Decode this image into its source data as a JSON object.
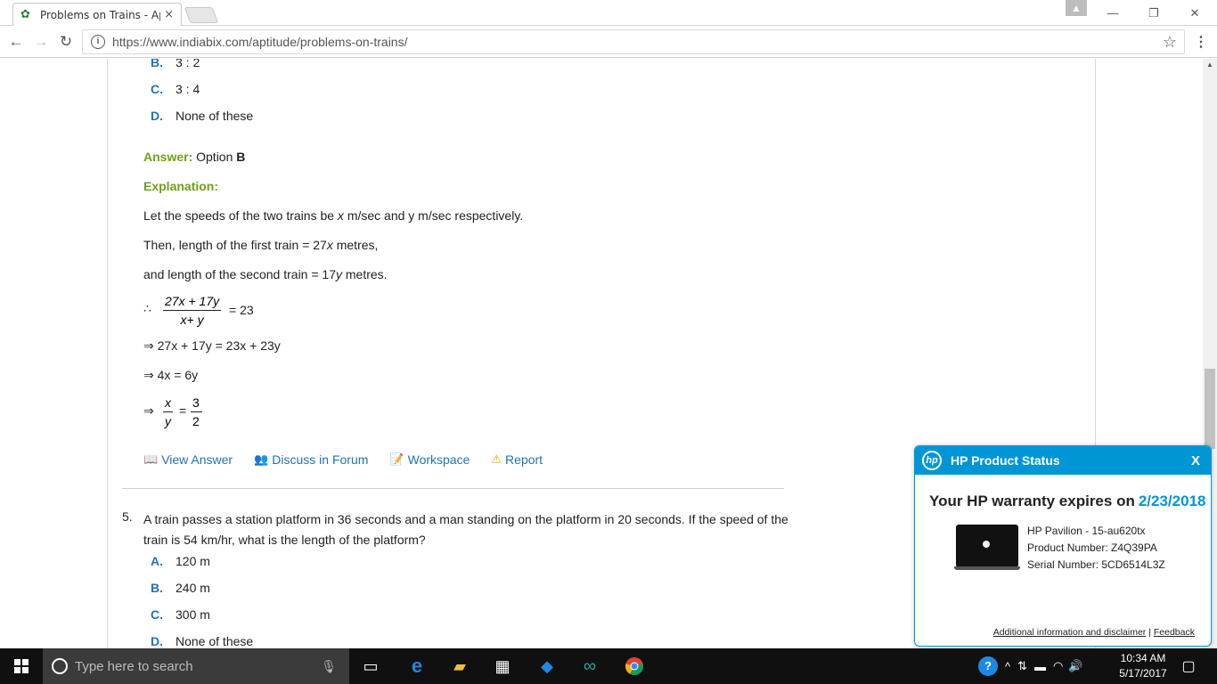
{
  "browser": {
    "tab_title": "Problems on Trains - Apt",
    "tab_close": "×",
    "url": "https://www.indiabix.com/aptitude/problems-on-trains/"
  },
  "prev_question": {
    "options": [
      {
        "letter": "B.",
        "text": "3 : 2"
      },
      {
        "letter": "C.",
        "text": "3 : 4"
      },
      {
        "letter": "D.",
        "text": "None of these"
      }
    ],
    "answer_label": "Answer:",
    "answer_prefix": "Option",
    "answer_value": "B",
    "explanation_label": "Explanation:",
    "exp_line1_a": "Let the speeds of the two trains be",
    "exp_line1_x": "x",
    "exp_line1_b": "m/sec and y m/sec respectively.",
    "exp_line2_a": "Then, length of the first train = 27",
    "exp_line2_x": "x",
    "exp_line2_b": "metres,",
    "exp_line3_a": "and length of the second train = 17",
    "exp_line3_y": "y",
    "exp_line3_b": "metres.",
    "therefore": "∴",
    "frac1_num": "27x + 17y",
    "frac1_den": "x+ y",
    "frac1_eq": "= 23",
    "step2": "⇒ 27x + 17y = 23x + 23y",
    "step3": "⇒ 4x = 6y",
    "step4_arrow": "⇒",
    "frac2_num": "x",
    "frac2_den": "y",
    "frac2_eq": "=",
    "frac3_num": "3",
    "frac3_den": "2",
    "frac3_dot": "."
  },
  "actions": {
    "view_answer": "View Answer",
    "discuss": "Discuss in Forum",
    "workspace": "Workspace",
    "report": "Report"
  },
  "question5": {
    "number": "5.",
    "text": "A train passes a station platform in 36 seconds and a man standing on the platform in 20 seconds. If the speed of the train is 54 km/hr, what is the length of the platform?",
    "options": [
      {
        "letter": "A.",
        "text": "120 m"
      },
      {
        "letter": "B.",
        "text": "240 m"
      },
      {
        "letter": "C.",
        "text": "300 m"
      },
      {
        "letter": "D.",
        "text": "None of these"
      }
    ]
  },
  "hp_popup": {
    "title": "HP Product Status",
    "close": "X",
    "warranty_text": "Your HP warranty expires on",
    "warranty_date": "2/23/2018",
    "model": "HP Pavilion - 15-au620tx",
    "product_number": "Product Number: Z4Q39PA",
    "serial_number": "Serial Number: 5CD6514L3Z",
    "disclaimer_link": "Additional information and disclaimer",
    "separator": "|",
    "feedback_link": "Feedback"
  },
  "taskbar": {
    "search_placeholder": "Type here to search",
    "time": "10:34 AM",
    "date": "5/17/2017"
  },
  "colors": {
    "link_blue": "#1f73b7",
    "answer_green": "#6ea11a",
    "hp_blue": "#0096d6"
  }
}
